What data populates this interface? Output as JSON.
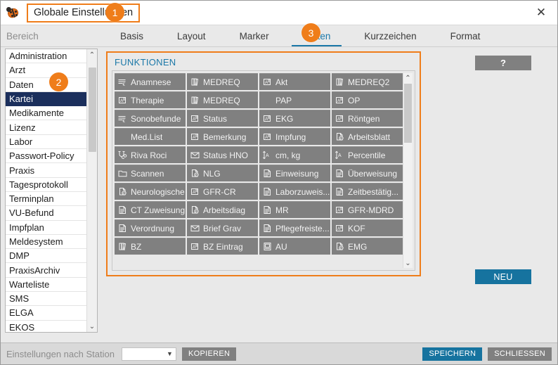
{
  "window": {
    "app_icon": "ladybug-icon",
    "title": "Globale Einstellungen",
    "close_label": "✕"
  },
  "tabbar": {
    "region_label": "Bereich",
    "tabs": [
      {
        "label": "Basis",
        "active": false
      },
      {
        "label": "Layout",
        "active": false
      },
      {
        "label": "Marker",
        "active": false
      },
      {
        "label": "Tasten",
        "active": true
      },
      {
        "label": "Kurzzeichen",
        "active": false
      },
      {
        "label": "Format",
        "active": false
      }
    ]
  },
  "sidebar": {
    "scroll_up": "⌃",
    "scroll_down": "⌄",
    "items": [
      {
        "label": "Administration",
        "selected": false
      },
      {
        "label": "Arzt",
        "selected": false
      },
      {
        "label": "Daten",
        "selected": false
      },
      {
        "label": "Kartei",
        "selected": true
      },
      {
        "label": "Medikamente",
        "selected": false
      },
      {
        "label": "Lizenz",
        "selected": false
      },
      {
        "label": "Labor",
        "selected": false
      },
      {
        "label": "Passwort-Policy",
        "selected": false
      },
      {
        "label": "Praxis",
        "selected": false
      },
      {
        "label": "Tagesprotokoll",
        "selected": false
      },
      {
        "label": "Terminplan",
        "selected": false
      },
      {
        "label": "VU-Befund",
        "selected": false
      },
      {
        "label": "Impfplan",
        "selected": false
      },
      {
        "label": "Meldesystem",
        "selected": false
      },
      {
        "label": "DMP",
        "selected": false
      },
      {
        "label": "PraxisArchiv",
        "selected": false
      },
      {
        "label": "Warteliste",
        "selected": false
      },
      {
        "label": "SMS",
        "selected": false
      },
      {
        "label": "ELGA",
        "selected": false
      },
      {
        "label": "EKOS",
        "selected": false
      }
    ]
  },
  "functions_panel": {
    "title": "FUNKTIONEN",
    "scroll_up": "⌃",
    "scroll_down": "⌄",
    "buttons": [
      {
        "label": "Anamnese",
        "icon": "list-euro-icon"
      },
      {
        "label": "MEDREQ",
        "icon": "books-icon"
      },
      {
        "label": "Akt",
        "icon": "text-card-icon"
      },
      {
        "label": "MEDREQ2",
        "icon": "books-icon"
      },
      {
        "label": "Therapie",
        "icon": "text-card-icon"
      },
      {
        "label": "MEDREQ",
        "icon": "books-icon"
      },
      {
        "label": "PAP",
        "icon": "none"
      },
      {
        "label": "OP",
        "icon": "text-card-icon"
      },
      {
        "label": "Sonobefunde",
        "icon": "list-euro-icon"
      },
      {
        "label": "Status",
        "icon": "text-card-icon"
      },
      {
        "label": "EKG",
        "icon": "text-card-icon"
      },
      {
        "label": "Röntgen",
        "icon": "text-card-icon"
      },
      {
        "label": "Med.List",
        "icon": "none"
      },
      {
        "label": "Bemerkung",
        "icon": "text-card-icon"
      },
      {
        "label": "Impfung",
        "icon": "text-card-icon"
      },
      {
        "label": "Arbeitsblatt",
        "icon": "page-euro-icon"
      },
      {
        "label": "Riva Roci",
        "icon": "stethoscope-icon"
      },
      {
        "label": "Status HNO",
        "icon": "envelope-icon"
      },
      {
        "label": "cm, kg",
        "icon": "measure-icon"
      },
      {
        "label": "Percentile",
        "icon": "measure-icon"
      },
      {
        "label": "Scannen",
        "icon": "folder-icon"
      },
      {
        "label": "NLG",
        "icon": "page-euro-icon"
      },
      {
        "label": "Einweisung",
        "icon": "form-icon"
      },
      {
        "label": "Überweisung",
        "icon": "form-icon"
      },
      {
        "label": "Neurologische",
        "icon": "page-euro-icon"
      },
      {
        "label": "GFR-CR",
        "icon": "text-card-icon"
      },
      {
        "label": "Laborzuweis...",
        "icon": "form-icon"
      },
      {
        "label": "Zeitbestätig...",
        "icon": "form-icon"
      },
      {
        "label": "CT Zuweisung",
        "icon": "form-icon"
      },
      {
        "label": "Arbeitsdiag",
        "icon": "page-euro-icon"
      },
      {
        "label": "MR",
        "icon": "form-icon"
      },
      {
        "label": "GFR-MDRD",
        "icon": "text-card-icon"
      },
      {
        "label": "Verordnung",
        "icon": "form-icon"
      },
      {
        "label": "Brief Grav",
        "icon": "envelope-icon"
      },
      {
        "label": "Pflegefreiste...",
        "icon": "form-icon"
      },
      {
        "label": "KOF",
        "icon": "text-card-icon"
      },
      {
        "label": "BZ",
        "icon": "books-icon"
      },
      {
        "label": "BZ Eintrag",
        "icon": "text-card-icon"
      },
      {
        "label": "AU",
        "icon": "doc-image-icon"
      },
      {
        "label": "EMG",
        "icon": "page-euro-icon"
      }
    ]
  },
  "side_actions": {
    "help_label": "?",
    "new_label": "NEU"
  },
  "footer": {
    "station_label": "Einstellungen nach Station",
    "station_value": "",
    "station_placeholder": "",
    "copy_label": "KOPIEREN",
    "save_label": "SPEICHERN",
    "close_label": "SCHLIESSEN"
  },
  "callouts": [
    {
      "number": "1"
    },
    {
      "number": "2"
    },
    {
      "number": "3"
    }
  ],
  "colors": {
    "accent_orange": "#ef7d1a",
    "accent_blue": "#1b78a8",
    "selected_navy": "#1b2f5c",
    "button_grey": "#808080",
    "window_bg": "#e9e9e9"
  }
}
